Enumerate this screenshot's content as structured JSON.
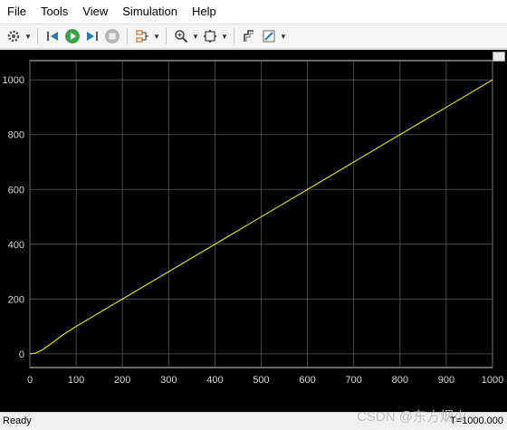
{
  "menu": {
    "items": [
      "File",
      "Tools",
      "View",
      "Simulation",
      "Help"
    ]
  },
  "toolbar": {
    "icons": [
      "gear-icon",
      "step-back-icon",
      "run-icon",
      "step-forward-icon",
      "stop-icon",
      "signal-select-icon",
      "zoom-icon",
      "fit-icon",
      "cursor-measure-icon",
      "style-icon"
    ]
  },
  "chart_data": {
    "type": "line",
    "xlim": [
      0,
      1000
    ],
    "ylim": [
      -50,
      1070
    ],
    "xticks": [
      "0",
      "100",
      "200",
      "300",
      "400",
      "500",
      "600",
      "700",
      "800",
      "900",
      "1000"
    ],
    "yticks": [
      "0",
      "200",
      "400",
      "600",
      "800",
      "1000"
    ],
    "grid": true,
    "series": [
      {
        "color": "#ffff00",
        "x": [
          0,
          10,
          20,
          30,
          50,
          70,
          100,
          200,
          300,
          400,
          500,
          600,
          700,
          800,
          900,
          1000
        ],
        "y": [
          0,
          2,
          8,
          18,
          42,
          68,
          100,
          200,
          300,
          400,
          500,
          600,
          700,
          800,
          900,
          1000
        ]
      }
    ]
  },
  "status": {
    "left": "Ready",
    "right": "T=1000.000",
    "watermark": "CSDN @东方烟火"
  }
}
